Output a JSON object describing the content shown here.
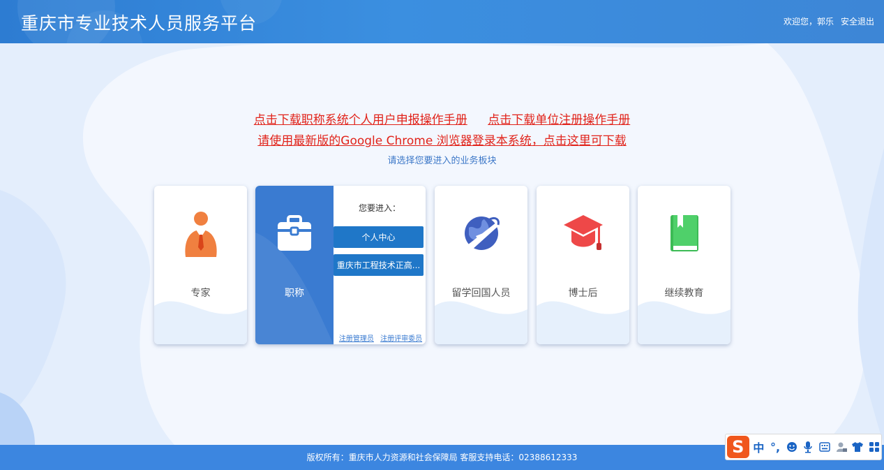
{
  "header": {
    "title": "重庆市专业技术人员服务平台",
    "welcome": "欢迎您，郭乐",
    "logout": "安全退出"
  },
  "notices": {
    "download_personal_manual": "点击下载职称系统个人用户申报操作手册",
    "download_unit_manual": "点击下载单位注册操作手册",
    "browser_tip": "请使用最新版的Google Chrome 浏览器登录本系统，点击这里可下载"
  },
  "subtitle": "请选择您要进入的业务板块",
  "cards": {
    "expert": {
      "label": "专家",
      "icon": "expert-person-icon",
      "color": "#f08040"
    },
    "title": {
      "label": "职称",
      "icon": "briefcase-icon",
      "prompt": "您要进入：",
      "btn_personal": "个人中心",
      "btn_engineering": "重庆市工程技术正高...",
      "link_register_admin": "注册管理员",
      "link_register_committee": "注册评审委员会"
    },
    "returnee": {
      "label": "留学回国人员",
      "icon": "globe-plane-icon",
      "color": "#3f5fbf"
    },
    "postdoc": {
      "label": "博士后",
      "icon": "graduation-cap-icon",
      "color": "#ee4848"
    },
    "education": {
      "label": "继续教育",
      "icon": "book-icon",
      "color": "#3cbb55"
    }
  },
  "footer": {
    "text": "版权所有：重庆市人力资源和社会保障局 客服支持电话：02388612333"
  },
  "ime": {
    "logo": "S",
    "mode": "中",
    "punct": "°,"
  },
  "colors": {
    "header_blue": "#2d7cd2",
    "link_red": "#e1231a",
    "button_blue": "#1f77c8",
    "footer_blue": "#3c86e0"
  }
}
